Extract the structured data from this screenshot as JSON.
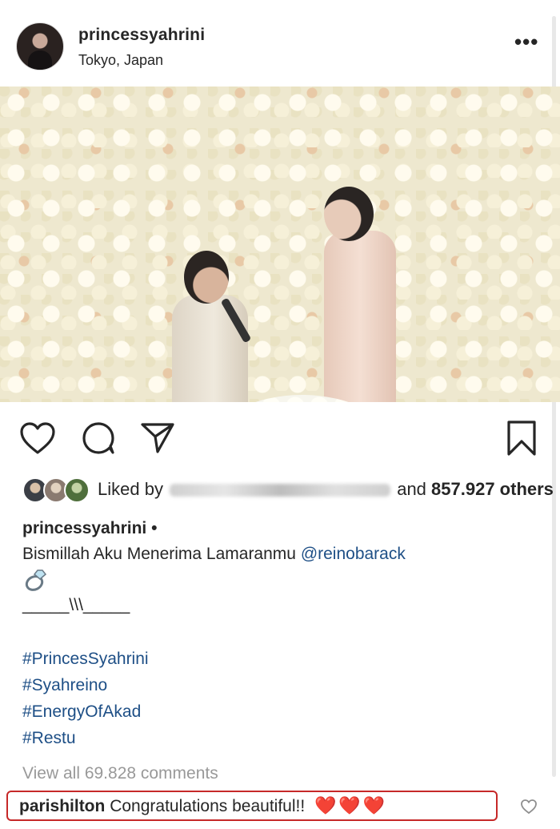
{
  "header": {
    "username": "princessyahrini",
    "location": "Tokyo, Japan",
    "more_label": "•••"
  },
  "actions": {
    "icons": [
      "heart-icon",
      "comment-icon",
      "share-icon",
      "bookmark-icon"
    ]
  },
  "likes": {
    "prefix": "Liked by",
    "middle": "and",
    "count_text": "857.927 others"
  },
  "caption": {
    "username": "princessyahrini",
    "separator": "•",
    "text": "Bismillah Aku Menerima Lamaranmu",
    "mention": "@reinobarack",
    "divider": "_____\\\\\\_____",
    "hashtags": [
      "#PrincesSyahrini",
      "#Syahreino",
      "#EnergyOfAkad",
      "#Restu"
    ]
  },
  "comments": {
    "view_all": "View all 69.828 comments",
    "top_comment": {
      "username": "parishilton",
      "text": "Congratulations beautiful!!",
      "emoji": "❤️❤️❤️"
    }
  },
  "colors": {
    "link": "#1e4f86",
    "highlight_border": "#c62828",
    "heart_emoji": "#e0262e"
  }
}
